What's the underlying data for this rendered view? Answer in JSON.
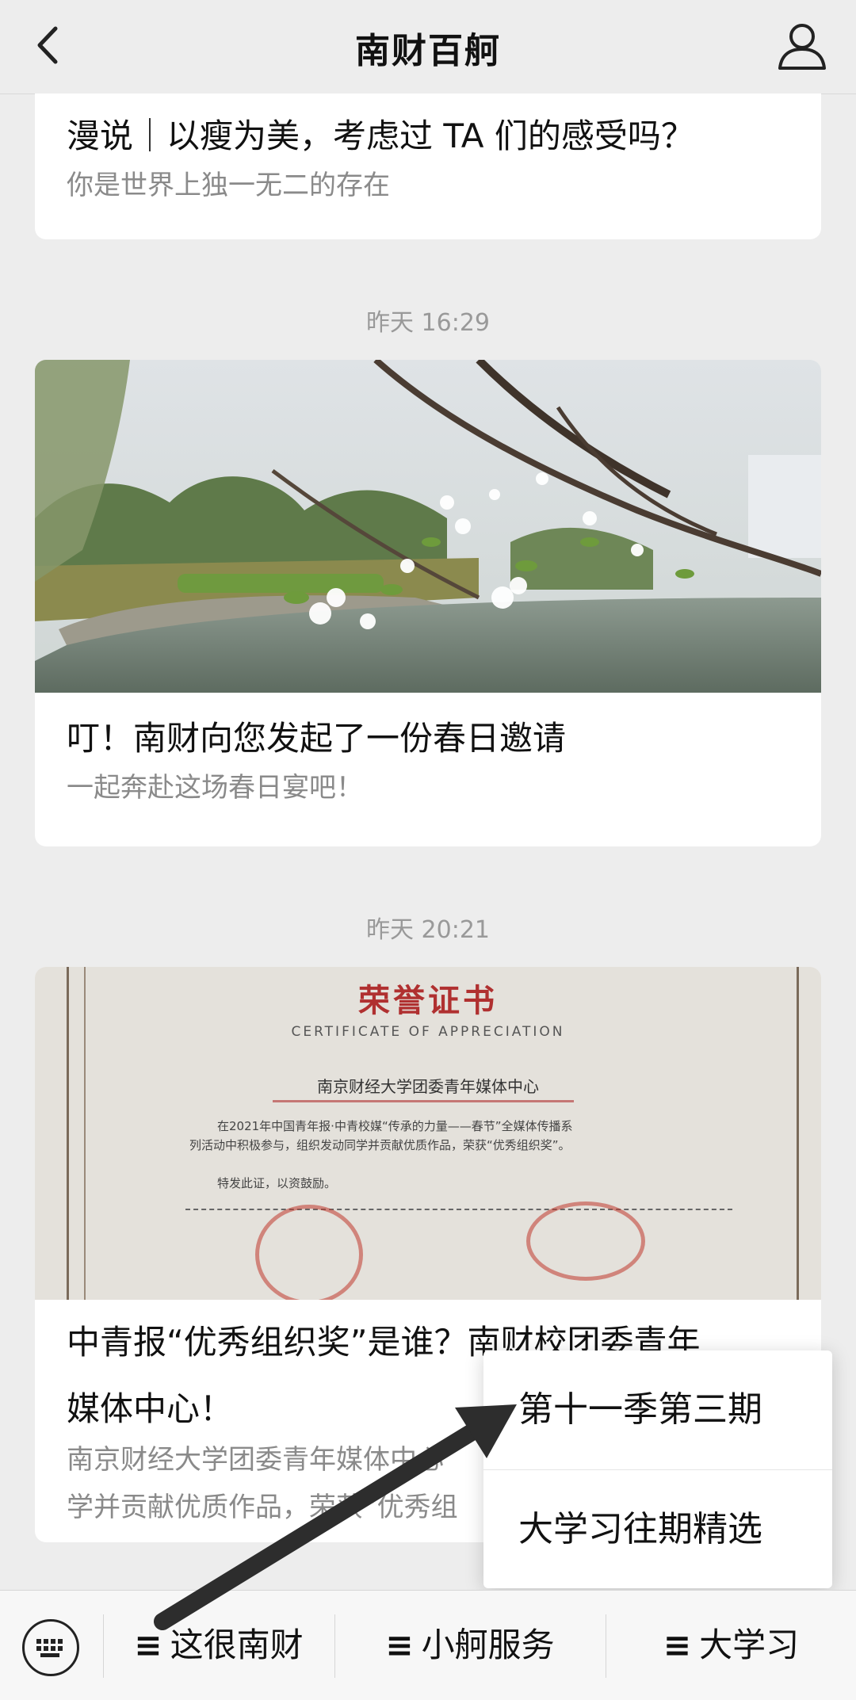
{
  "header": {
    "title": "南财百舸",
    "back_icon": "chevron-left-icon",
    "profile_icon": "person-icon"
  },
  "articles": [
    {
      "title": "漫说｜以瘦为美，考虑过 TA 们的感受吗？",
      "summary": "你是世界上独一无二的存在"
    },
    {
      "timestamp": "昨天 16:29",
      "title": "叮！南财向您发起了一份春日邀请",
      "summary": "一起奔赴这场春日宴吧！"
    },
    {
      "timestamp": "昨天 20:21",
      "title_line1": "中青报“优秀组织奖”是谁？南财校团委青年",
      "title_line2": "媒体中心！",
      "summary_line1": "南京财经大学团委青年媒体中心",
      "summary_line2": "学并贡献优质作品，荣获“优秀组",
      "certificate": {
        "title": "荣誉证书",
        "subtitle": "CERTIFICATE OF APPRECIATION",
        "recipient": "南京财经大学团委青年媒体中心",
        "body_line1": "在2021年中国青年报·中青校媒“传承的力量——春节”全媒体传播系",
        "body_line2": "列活动中积极参与，组织发动同学并贡献优质作品，荣获“优秀组织奖”。",
        "closing": "特发此证，以资鼓励。"
      }
    }
  ],
  "popup_menu": {
    "items": [
      "第十一季第三期",
      "大学习往期精选"
    ]
  },
  "bottom_menu": {
    "keyboard_icon": "keyboard-icon",
    "items": [
      "这很南财",
      "小舸服务",
      "大学习"
    ],
    "menu_icon_glyph": "≡"
  },
  "colors": {
    "background": "#ededed",
    "card": "#ffffff",
    "summary_text": "#8a8a8a",
    "certificate_red": "#b03030",
    "arrow": "#2d2d2d"
  }
}
